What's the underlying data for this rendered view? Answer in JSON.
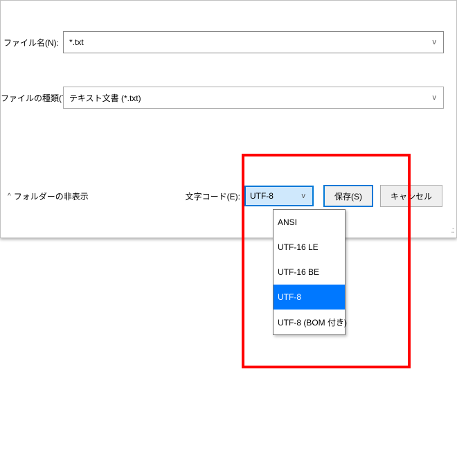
{
  "labels": {
    "filename": "ファイル名(N):",
    "filetype": "ファイルの種類(T):",
    "encoding": "文字コード(E):",
    "hideFolders": "フォルダーの非表示"
  },
  "values": {
    "filename": "*.txt",
    "filetype": "テキスト文書 (*.txt)",
    "encoding": "UTF-8"
  },
  "buttons": {
    "save": "保存(S)",
    "cancel": "キャンセル"
  },
  "encodingOptions": {
    "o0": "ANSI",
    "o1": "UTF-16 LE",
    "o2": "UTF-16 BE",
    "o3": "UTF-8",
    "o4": "UTF-8 (BOM 付き)"
  },
  "glyphs": {
    "chevDown": "v",
    "caretUp": "^",
    "grip": ".::"
  }
}
